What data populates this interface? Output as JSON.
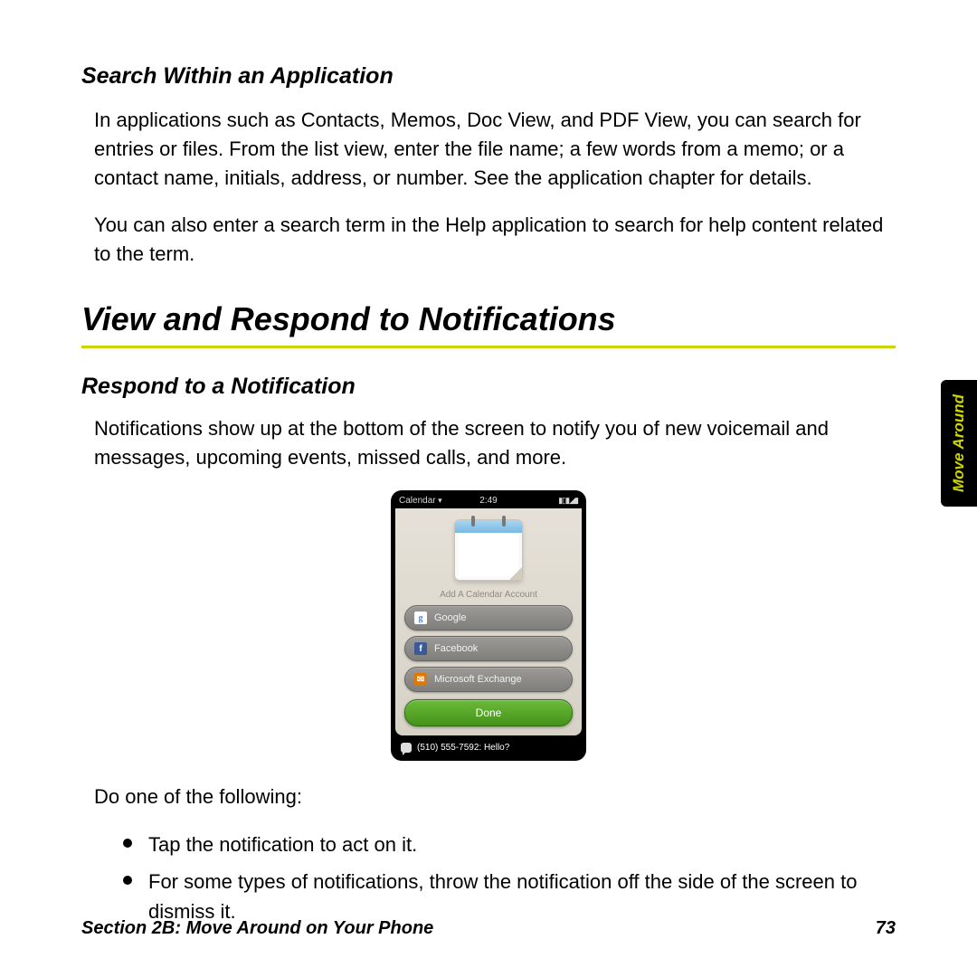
{
  "headings": {
    "search_within": "Search Within an Application",
    "view_respond": "View and Respond to Notifications",
    "respond_notif": "Respond to a Notification"
  },
  "paragraphs": {
    "p1": "In applications such as Contacts, Memos, Doc View, and PDF View, you can search for entries or files. From the list view, enter the file name; a few words from a memo; or a contact name, initials, address, or number. See the application chapter for details.",
    "p2": "You can also enter a search term in the Help application to search for help content related to the term.",
    "p3": "Notifications show up at the bottom of the screen to notify you of new voicemail and messages, upcoming events, missed calls, and more.",
    "do_one": "Do one of the following:"
  },
  "bullets": {
    "b1": "Tap the notification to act on it.",
    "b2": "For some types of notifications, throw the notification off the side of the screen to dismiss it."
  },
  "phone": {
    "app_name": "Calendar",
    "time": "2:49",
    "add_account": "Add A Calendar Account",
    "options": {
      "google": "Google",
      "facebook": "Facebook",
      "exchange": "Microsoft Exchange"
    },
    "done": "Done",
    "notification": "(510) 555-7592: Hello?"
  },
  "footer": {
    "left": "Section 2B: Move Around on Your Phone",
    "right": "73"
  },
  "sidetab": "Move Around"
}
